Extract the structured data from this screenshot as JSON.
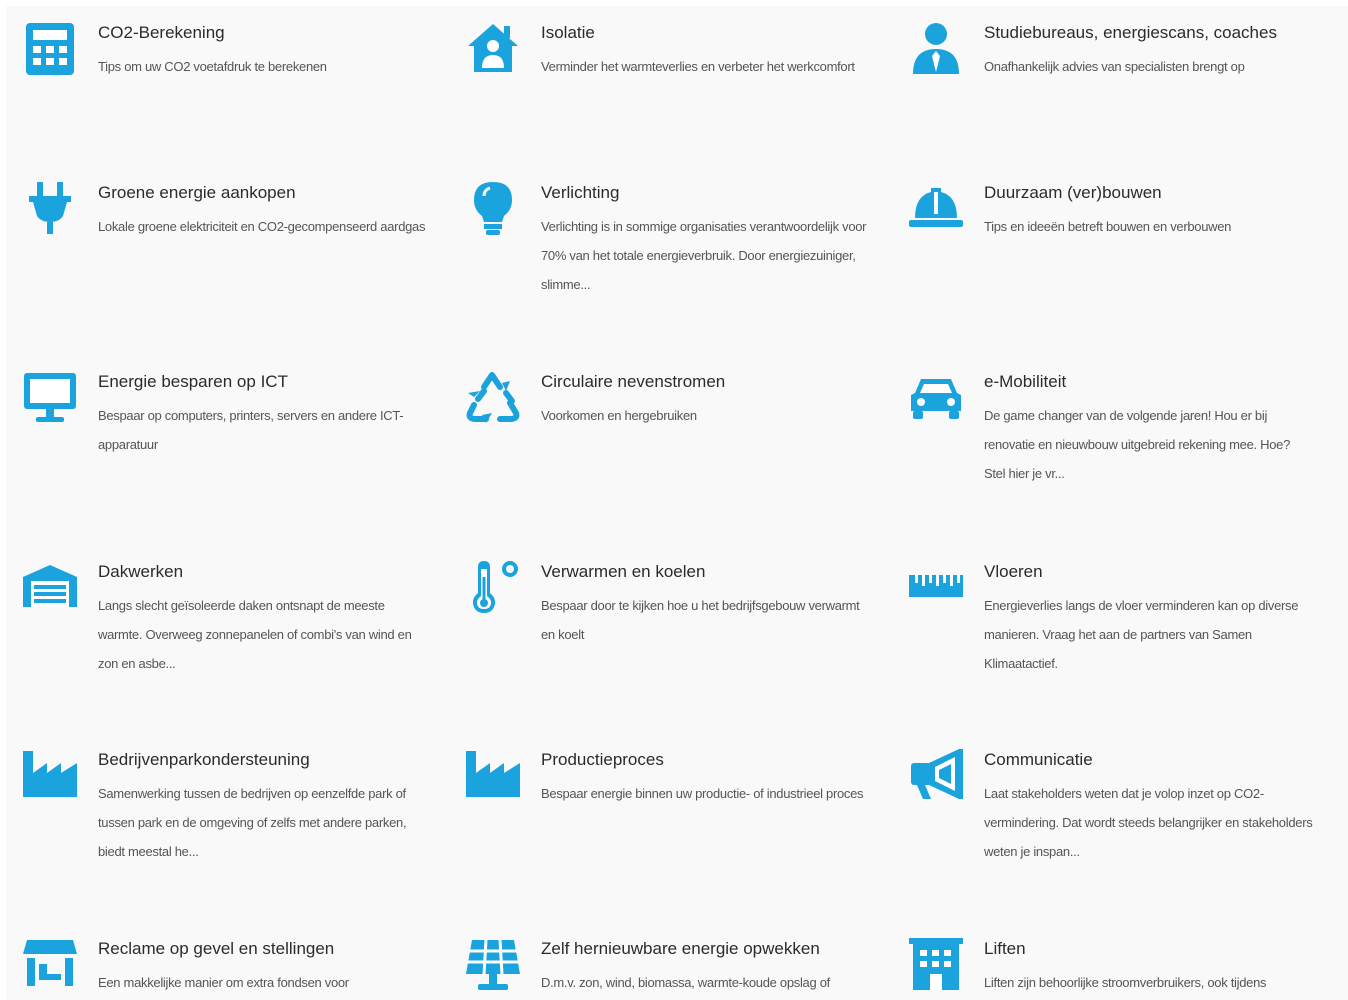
{
  "accent_color": "#1ba3dd",
  "tiles": [
    {
      "title": "CO2-Berekening",
      "desc": "Tips om uw CO2 voetafdruk te berekenen",
      "icon": "calculator-icon"
    },
    {
      "title": "Isolatie",
      "desc": "Verminder het warmteverlies en verbeter het werkcomfort",
      "icon": "house-icon"
    },
    {
      "title": "Studiebureaus, energiescans, coaches",
      "desc": "Onafhankelijk advies van specialisten brengt op",
      "icon": "person-icon"
    },
    {
      "title": "Groene energie aankopen",
      "desc": "Lokale groene elektriciteit en CO2-gecompenseerd aardgas",
      "icon": "plug-icon"
    },
    {
      "title": "Verlichting",
      "desc": "Verlichting is in sommige organisaties verantwoordelijk voor 70% van het totale energieverbruik. Door energiezuiniger, slimme...",
      "icon": "lightbulb-icon"
    },
    {
      "title": "Duurzaam (ver)bouwen",
      "desc": "Tips en ideeën betreft bouwen en verbouwen",
      "icon": "hardhat-icon"
    },
    {
      "title": "Energie besparen op ICT",
      "desc": "Bespaar op computers, printers, servers en andere ICT-apparatuur",
      "icon": "monitor-icon"
    },
    {
      "title": "Circulaire nevenstromen",
      "desc": "Voorkomen en hergebruiken",
      "icon": "recycle-icon"
    },
    {
      "title": "e-Mobiliteit",
      "desc": "De game changer van de volgende jaren! Hou er bij renovatie en nieuwbouw uitgebreid rekening mee. Hoe? Stel hier je vr...",
      "icon": "car-icon"
    },
    {
      "title": "Dakwerken",
      "desc": "Langs slecht geïsoleerde daken ontsnapt de meeste warmte. Overweeg zonnepanelen of combi's van wind en zon en asbe...",
      "icon": "warehouse-icon"
    },
    {
      "title": "Verwarmen en koelen",
      "desc": "Bespaar door te kijken hoe u het bedrijfsgebouw verwarmt en koelt",
      "icon": "thermometer-icon"
    },
    {
      "title": "Vloeren",
      "desc": "Energieverlies langs de vloer verminderen kan op diverse manieren. Vraag het aan de partners van Samen Klimaatactief.",
      "icon": "ruler-icon"
    },
    {
      "title": "Bedrijvenparkondersteuning",
      "desc": "Samenwerking tussen de bedrijven op eenzelfde park of tussen park en de omgeving of zelfs met andere parken, biedt meestal he...",
      "icon": "factory-icon"
    },
    {
      "title": "Productieproces",
      "desc": "Bespaar energie binnen uw productie- of industrieel proces",
      "icon": "factory-icon"
    },
    {
      "title": "Communicatie",
      "desc": "Laat stakeholders weten dat je volop inzet op CO2-vermindering. Dat wordt steeds belangrijker en stakeholders weten je inspan...",
      "icon": "megaphone-icon"
    },
    {
      "title": "Reclame op gevel en stellingen",
      "desc": "Een makkelijke manier om extra fondsen voor",
      "icon": "storefront-icon"
    },
    {
      "title": "Zelf hernieuwbare energie opwekken",
      "desc": "D.m.v. zon, wind, biomassa, warmte-koude opslag of",
      "icon": "solar-panel-icon"
    },
    {
      "title": "Liften",
      "desc": "Liften zijn behoorlijke stroomverbruikers, ook tijdens",
      "icon": "building-icon"
    }
  ]
}
